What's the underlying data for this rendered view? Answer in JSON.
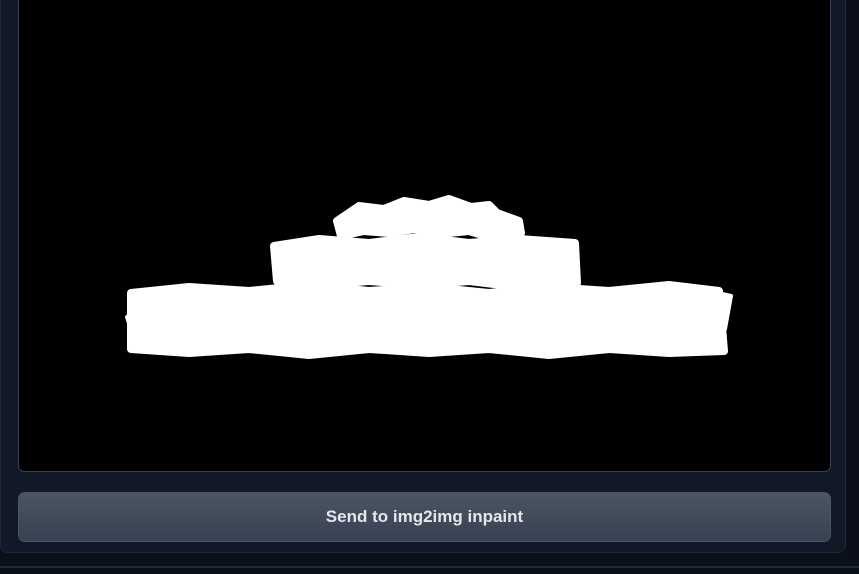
{
  "output_image": {
    "description_alt": "Inpainting mask",
    "background_color": "#000000",
    "mask_color": "#ffffff"
  },
  "actions": {
    "send_to_inpaint_label": "Send to img2img inpaint"
  },
  "colors": {
    "page_bg": "#0b0f19",
    "panel_bg": "#111827",
    "border": "#374151",
    "button_text": "#e5e7eb"
  }
}
